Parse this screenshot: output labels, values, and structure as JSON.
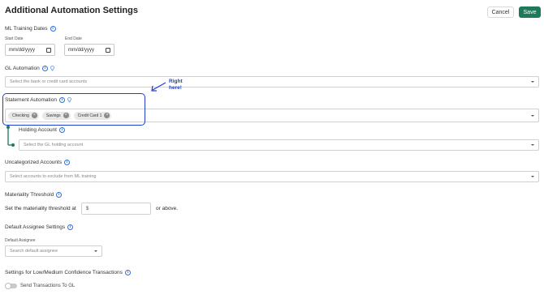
{
  "header": {
    "title": "Additional Automation Settings",
    "cancel_label": "Cancel",
    "save_label": "Save"
  },
  "ml_training": {
    "label": "ML Training Dates",
    "start_label": "Start Date",
    "start_value": "mm/dd/yyyy",
    "end_label": "End Date",
    "end_value": "mm/dd/yyyy"
  },
  "gl_automation": {
    "label": "GL Automation",
    "placeholder": "Select the bank or credit card accounts"
  },
  "annotation": {
    "line1": "Right",
    "line2": "here!",
    "color": "#1d3fd1"
  },
  "statement_automation": {
    "label": "Statement Automation",
    "chips": [
      "Checking",
      "Savings",
      "Credit Card 1"
    ]
  },
  "holding_account": {
    "label": "Holding Account",
    "placeholder": "Select the GL holding account"
  },
  "uncategorized": {
    "label": "Uncategorized Accounts",
    "placeholder": "Select accounts to exclude from ML training"
  },
  "materiality": {
    "label": "Materiality Threshold",
    "prefix_text": "Set the materiality threshold at",
    "currency": "$",
    "suffix_text": "or above."
  },
  "default_assignee": {
    "label": "Default Assignee Settings",
    "sub_label": "Default Assignee",
    "placeholder": "Search default assignee"
  },
  "low_confidence": {
    "label": "Settings for Low/Medium Confidence Transactions",
    "toggle_label": "Send Transactions To GL",
    "toggle_on": false
  },
  "colors": {
    "accent": "#1f7a5c",
    "info": "#2f6fd6"
  }
}
